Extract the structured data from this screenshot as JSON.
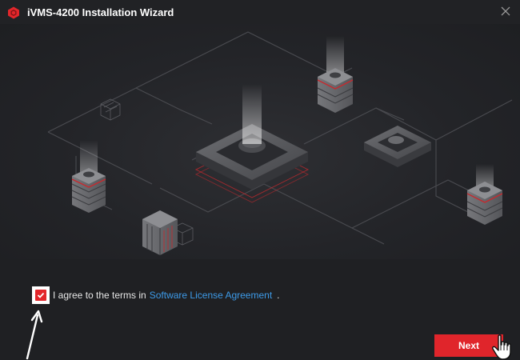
{
  "window": {
    "title": "iVMS-4200 Installation Wizard",
    "logo_icon": "hikvision-logo-icon",
    "close_icon": "close-icon",
    "accent_color": "#e0252b",
    "background_color": "#212225"
  },
  "hero": {
    "illustration": "isometric-servers-network-illustration"
  },
  "agreement": {
    "checked": true,
    "text": "I agree to the terms in",
    "link_text": "Software License Agreement",
    "period": ".",
    "link_color": "#3d9be9"
  },
  "actions": {
    "next_label": "Next"
  },
  "annotations": {
    "arrow_icon": "pointer-arrow-icon",
    "cursor_icon": "hand-cursor-icon"
  }
}
